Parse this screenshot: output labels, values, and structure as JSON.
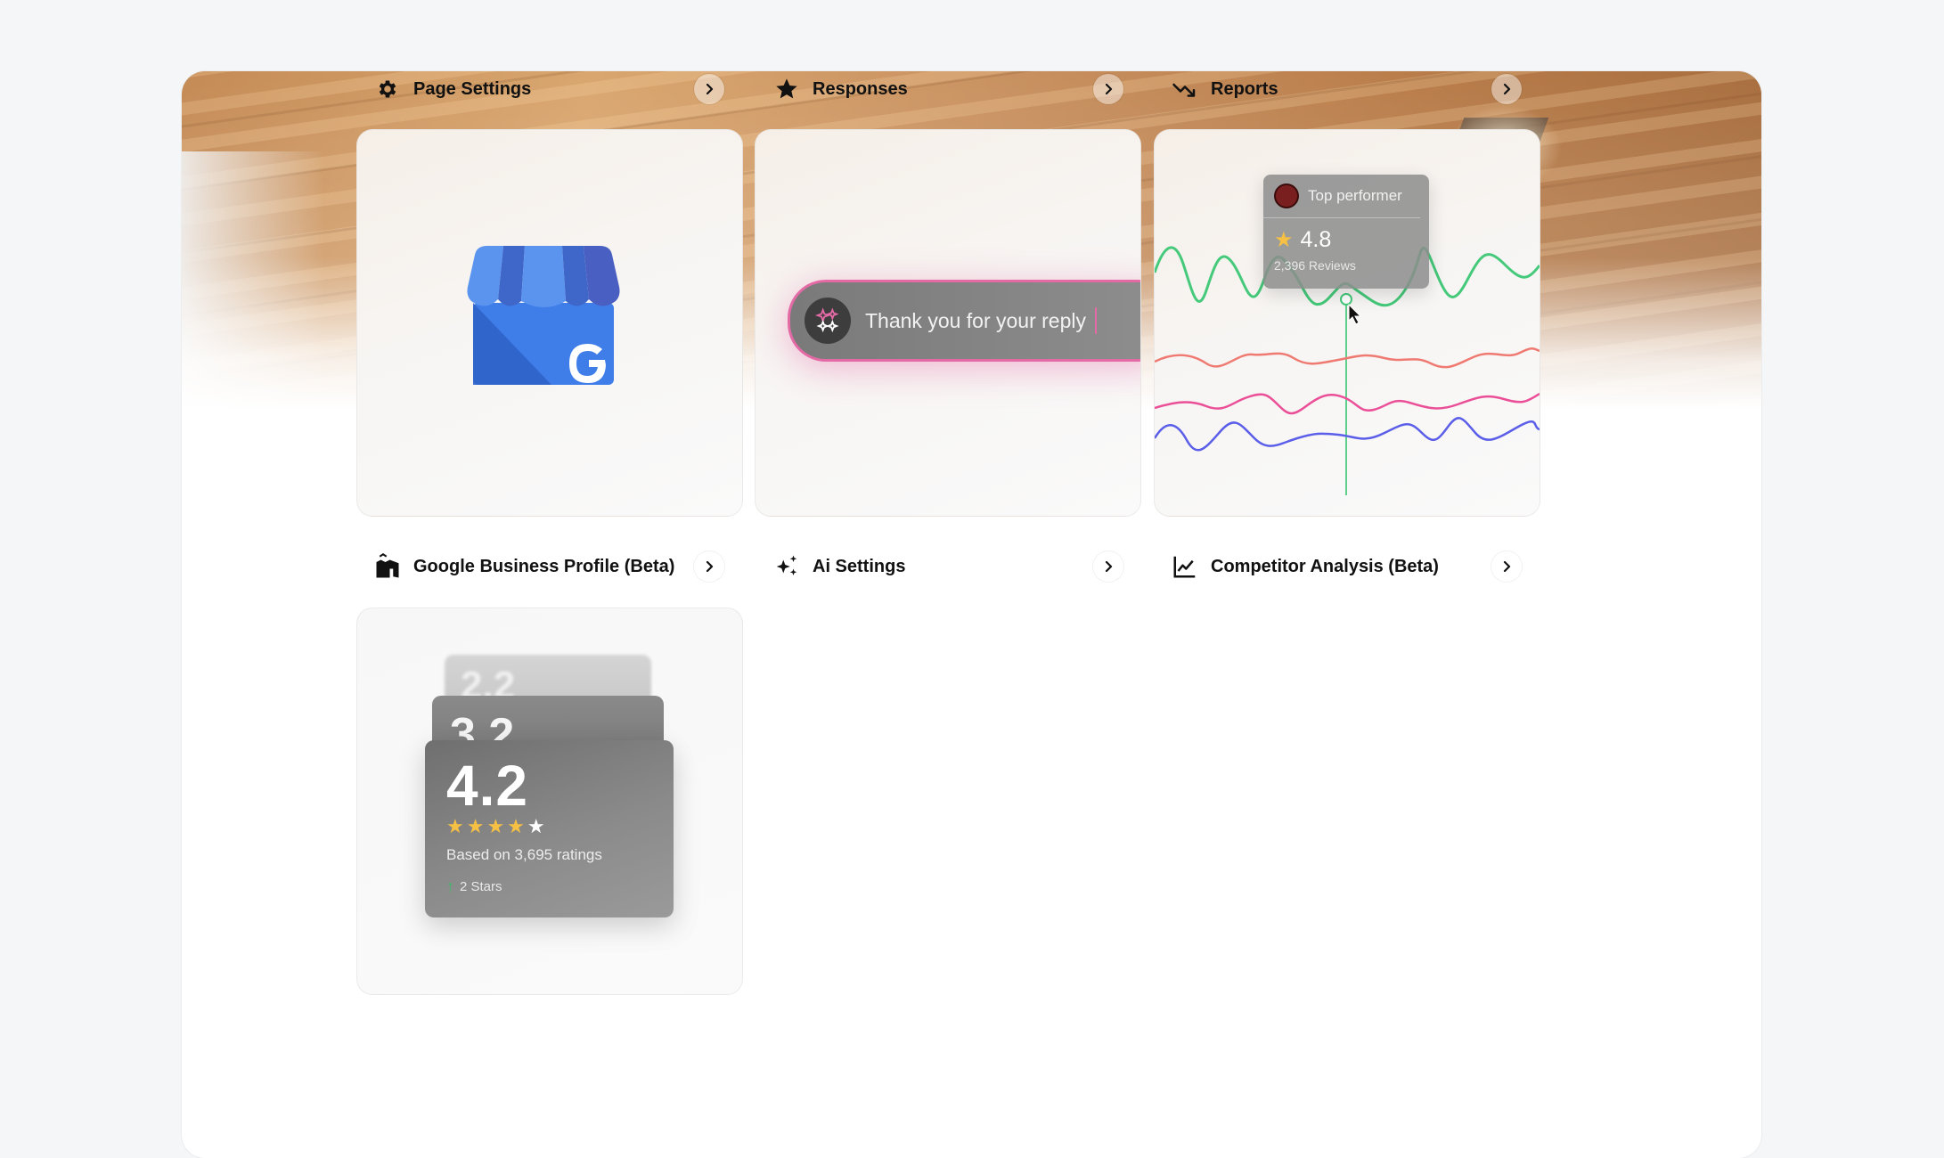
{
  "top_row": [
    {
      "id": "page-settings",
      "icon": "gear-icon",
      "label": "Page Settings"
    },
    {
      "id": "responses",
      "icon": "star-icon",
      "label": "Responses"
    },
    {
      "id": "reports",
      "icon": "trend-arrow-icon",
      "label": "Reports"
    }
  ],
  "cards": {
    "gbp": {
      "label": "Google Business Profile (Beta)",
      "icon": "store-map-icon",
      "illustration": "google-my-business-store-icon",
      "letter": "G"
    },
    "ai": {
      "label": "Ai Settings",
      "icon": "sparkles-icon",
      "reply_text": "Thank you for your reply"
    },
    "competitor": {
      "label": "Competitor Analysis (Beta)",
      "icon": "line-chart-icon",
      "tooltip": {
        "title": "Top performer",
        "rating": "4.8",
        "reviews": "2,396 Reviews"
      },
      "series_colors": {
        "green": "#45c97a",
        "salmon": "#ef7a72",
        "pink": "#ea4f97",
        "blue": "#5b5ee8"
      }
    },
    "rating": {
      "back2": "2.2",
      "back1": "3.2",
      "value": "4.2",
      "stars_filled": 4,
      "stars_total": 5,
      "stars_filled_text": "★★★★",
      "stars_empty_text": "★",
      "based_on": "Based on 3,695 ratings",
      "trend": "2 Stars"
    }
  },
  "colors": {
    "accent_pink": "#e46aa6",
    "star_yellow": "#f5c043",
    "google_blue": "#3f7de8"
  }
}
